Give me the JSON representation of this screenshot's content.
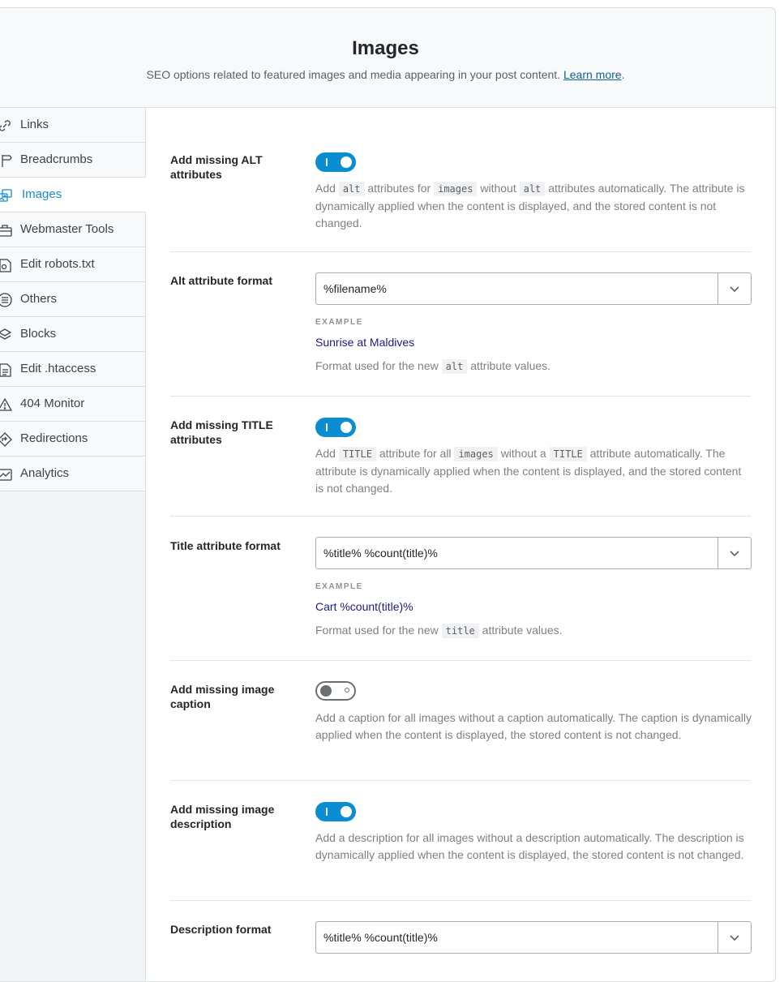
{
  "header": {
    "title": "Images",
    "subtitle": "SEO options related to featured images and media appearing in your post content.",
    "learn_more": "Learn more",
    "period": "."
  },
  "sidebar": {
    "items": [
      {
        "label": "Links",
        "icon": "links-icon"
      },
      {
        "label": "Breadcrumbs",
        "icon": "signpost-icon"
      },
      {
        "label": "Images",
        "icon": "images-icon",
        "active": true
      },
      {
        "label": "Webmaster Tools",
        "icon": "toolbox-icon"
      },
      {
        "label": "Edit robots.txt",
        "icon": "robot-file-icon"
      },
      {
        "label": "Others",
        "icon": "list-circle-icon"
      },
      {
        "label": "Blocks",
        "icon": "blocks-icon"
      },
      {
        "label": "Edit .htaccess",
        "icon": "htaccess-file-icon"
      },
      {
        "label": "404 Monitor",
        "icon": "warning-icon"
      },
      {
        "label": "Redirections",
        "icon": "redirect-sign-icon"
      },
      {
        "label": "Analytics",
        "icon": "analytics-chart-icon"
      }
    ]
  },
  "settings": {
    "alt_toggle": {
      "label": "Add missing ALT attributes",
      "enabled": true,
      "desc": {
        "p1": "Add",
        "c1": "alt",
        "p2": "attributes for",
        "c2": "images",
        "p3": "without",
        "c3": "alt",
        "p4": "attributes automatically. The attribute is dynamically applied when the content is displayed, and the stored content is not changed."
      }
    },
    "alt_format": {
      "label": "Alt attribute format",
      "value": "%filename%",
      "example_label": "EXAMPLE",
      "example_value": "Sunrise at Maldives",
      "desc_p1": "Format used for the new",
      "desc_code": "alt",
      "desc_p2": "attribute values."
    },
    "title_toggle": {
      "label": "Add missing TITLE attributes",
      "enabled": true,
      "desc": {
        "p1": "Add",
        "c1": "TITLE",
        "p2": "attribute for all",
        "c2": "images",
        "p3": "without a",
        "c3": "TITLE",
        "p4": "attribute automatically. The attribute is dynamically applied when the content is displayed, and the stored content is not changed."
      }
    },
    "title_format": {
      "label": "Title attribute format",
      "value": "%title% %count(title)%",
      "example_label": "EXAMPLE",
      "example_value": "Cart %count(title)%",
      "desc_p1": "Format used for the new",
      "desc_code": "title",
      "desc_p2": "attribute values."
    },
    "caption_toggle": {
      "label": "Add missing image caption",
      "enabled": false,
      "desc": "Add a caption for all images without a caption automatically. The caption is dynamically applied when the content is displayed, the stored content is not changed."
    },
    "description_toggle": {
      "label": "Add missing image description",
      "enabled": true,
      "desc": "Add a description for all images without a description automatically. The description is dynamically applied when the content is displayed, the stored content is not changed."
    },
    "description_format": {
      "label": "Description format",
      "value": "%title% %count(title)%"
    }
  },
  "colors": {
    "accent": "#0b8ed1",
    "active_nav": "#1a8ad4",
    "link": "#10609a",
    "example_value": "#1a1a8a"
  }
}
